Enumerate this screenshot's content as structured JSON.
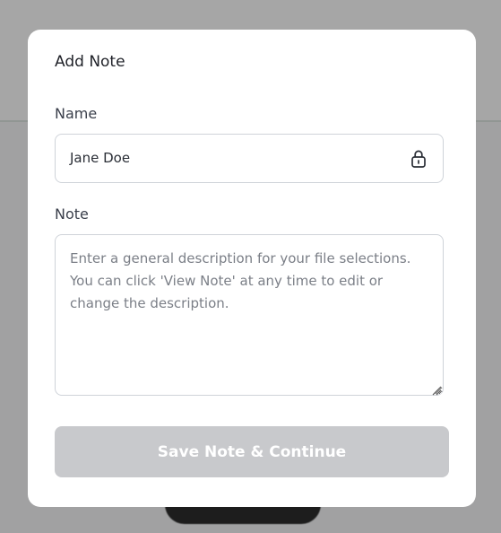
{
  "modal": {
    "title": "Add Note",
    "name_label": "Name",
    "name_value": "Jane Doe",
    "note_label": "Note",
    "note_placeholder": "Enter a general description for your file selections. You can click 'View Note' at any time to edit or change the description.",
    "save_button_label": "Save Note & Continue",
    "save_button_disabled": true
  },
  "icons": {
    "name_field_icon": "lock-icon",
    "note_field_handle": "resize-handle-icon"
  },
  "colors": {
    "overlay": "#00000059",
    "button_disabled": "#c8c9cc",
    "border": "#cfd3d9"
  }
}
